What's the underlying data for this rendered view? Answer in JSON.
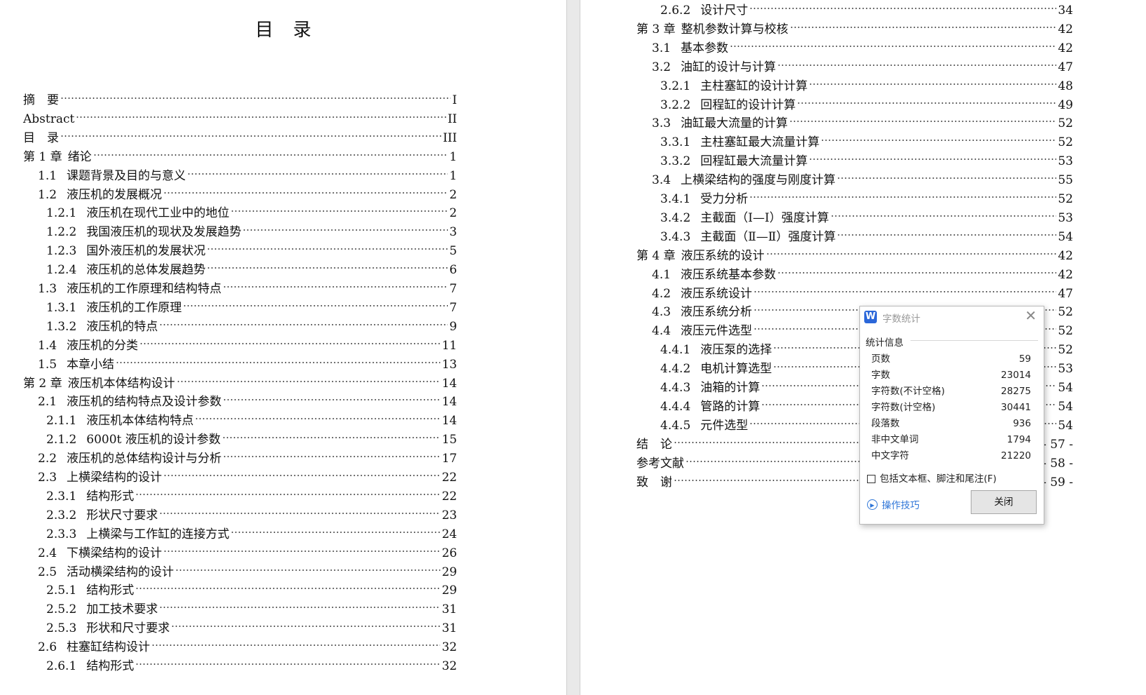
{
  "left_page": {
    "title": "目录",
    "entries": [
      {
        "level": 0,
        "num": "",
        "title": "摘　要",
        "page": "I"
      },
      {
        "level": 0,
        "num": "",
        "title": "Abstract",
        "page": "II"
      },
      {
        "level": 0,
        "num": "",
        "title": "目　录",
        "page": "III"
      },
      {
        "level": 1,
        "num": "第 1 章",
        "title": "绪论",
        "page": "1"
      },
      {
        "level": 2,
        "num": "1.1",
        "title": "课题背景及目的与意义",
        "page": "1"
      },
      {
        "level": 2,
        "num": "1.2",
        "title": "液压机的发展概况",
        "page": "2"
      },
      {
        "level": 3,
        "num": "1.2.1",
        "title": "液压机在现代工业中的地位",
        "page": "2"
      },
      {
        "level": 3,
        "num": "1.2.2",
        "title": "我国液压机的现状及发展趋势",
        "page": "3"
      },
      {
        "level": 3,
        "num": "1.2.3",
        "title": "国外液压机的发展状况",
        "page": "5"
      },
      {
        "level": 3,
        "num": "1.2.4",
        "title": "液压机的总体发展趋势",
        "page": "6"
      },
      {
        "level": 2,
        "num": "1.3",
        "title": "液压机的工作原理和结构特点",
        "page": "7"
      },
      {
        "level": 3,
        "num": "1.3.1",
        "title": "液压机的工作原理",
        "page": "7"
      },
      {
        "level": 3,
        "num": "1.3.2",
        "title": "液压机的特点",
        "page": "9"
      },
      {
        "level": 2,
        "num": "1.4",
        "title": "液压机的分类",
        "page": "11"
      },
      {
        "level": 2,
        "num": "1.5",
        "title": "本章小结",
        "page": "13"
      },
      {
        "level": 1,
        "num": "第 2 章",
        "title": "液压机本体结构设计",
        "page": "14"
      },
      {
        "level": 2,
        "num": "2.1",
        "title": "液压机的结构特点及设计参数",
        "page": "14"
      },
      {
        "level": 3,
        "num": "2.1.1",
        "title": "液压机本体结构特点",
        "page": "14"
      },
      {
        "level": 3,
        "num": "2.1.2",
        "title": "6000t 液压机的设计参数",
        "page": "15"
      },
      {
        "level": 2,
        "num": "2.2",
        "title": "液压机的总体结构设计与分析",
        "page": "17"
      },
      {
        "level": 2,
        "num": "2.3",
        "title": "上横梁结构的设计",
        "page": "22"
      },
      {
        "level": 3,
        "num": "2.3.1",
        "title": "结构形式",
        "page": "22"
      },
      {
        "level": 3,
        "num": "2.3.2",
        "title": "形状尺寸要求",
        "page": "23"
      },
      {
        "level": 3,
        "num": "2.3.3",
        "title": "上横梁与工作缸的连接方式",
        "page": "24"
      },
      {
        "level": 2,
        "num": "2.4",
        "title": "下横梁结构的设计",
        "page": "26"
      },
      {
        "level": 2,
        "num": "2.5",
        "title": "活动横梁结构的设计",
        "page": "29"
      },
      {
        "level": 3,
        "num": "2.5.1",
        "title": "结构形式",
        "page": "29"
      },
      {
        "level": 3,
        "num": "2.5.2",
        "title": "加工技术要求",
        "page": "31"
      },
      {
        "level": 3,
        "num": "2.5.3",
        "title": "形状和尺寸要求",
        "page": "31"
      },
      {
        "level": 2,
        "num": "2.6",
        "title": "柱塞缸结构设计",
        "page": "32"
      },
      {
        "level": 3,
        "num": "2.6.1",
        "title": "结构形式",
        "page": "32"
      }
    ]
  },
  "right_page": {
    "entries": [
      {
        "level": 3,
        "num": "2.6.2",
        "title": "设计尺寸",
        "page": "34"
      },
      {
        "level": 1,
        "num": "第 3 章",
        "title": "整机参数计算与校核",
        "page": "42"
      },
      {
        "level": 2,
        "num": "3.1",
        "title": "基本参数",
        "page": "42"
      },
      {
        "level": 2,
        "num": "3.2",
        "title": "油缸的设计与计算",
        "page": "47"
      },
      {
        "level": 3,
        "num": "3.2.1",
        "title": "主柱塞缸的设计计算",
        "page": "48"
      },
      {
        "level": 3,
        "num": "3.2.2",
        "title": "回程缸的设计计算",
        "page": "49"
      },
      {
        "level": 2,
        "num": "3.3",
        "title": "油缸最大流量的计算",
        "page": "52"
      },
      {
        "level": 3,
        "num": "3.3.1",
        "title": "主柱塞缸最大流量计算",
        "page": "52"
      },
      {
        "level": 3,
        "num": "3.3.2",
        "title": "回程缸最大流量计算",
        "page": "53"
      },
      {
        "level": 2,
        "num": "3.4",
        "title": "上横梁结构的强度与刚度计算",
        "page": "55"
      },
      {
        "level": 3,
        "num": "3.4.1",
        "title": "受力分析",
        "page": "52"
      },
      {
        "level": 3,
        "num": "3.4.2",
        "title": "主截面（Ⅰ—Ⅰ）强度计算",
        "page": "53"
      },
      {
        "level": 3,
        "num": "3.4.3",
        "title": "主截面（Ⅱ—Ⅱ）强度计算",
        "page": "54"
      },
      {
        "level": 1,
        "num": "第 4 章",
        "title": "液压系统的设计",
        "page": "42"
      },
      {
        "level": 2,
        "num": "4.1",
        "title": "液压系统基本参数",
        "page": "42"
      },
      {
        "level": 2,
        "num": "4.2",
        "title": "液压系统设计",
        "page": "47"
      },
      {
        "level": 2,
        "num": "4.3",
        "title": "液压系统分析",
        "page": "52"
      },
      {
        "level": 2,
        "num": "4.4",
        "title": "液压元件选型",
        "page": "52"
      },
      {
        "level": 3,
        "num": "4.4.1",
        "title": "液压泵的选择",
        "page": "52"
      },
      {
        "level": 3,
        "num": "4.4.2",
        "title": "电机计算选型",
        "page": "53"
      },
      {
        "level": 3,
        "num": "4.4.3",
        "title": "油箱的计算",
        "page": "54"
      },
      {
        "level": 3,
        "num": "4.4.4",
        "title": "管路的计算",
        "page": "54"
      },
      {
        "level": 3,
        "num": "4.4.5",
        "title": "元件选型",
        "page": "54"
      },
      {
        "level": 0,
        "num": "",
        "title": "结　论",
        "page": "- 57 -"
      },
      {
        "level": 0,
        "num": "",
        "title": "参考文献",
        "page": "- 58 -"
      },
      {
        "level": 0,
        "num": "",
        "title": "致　谢",
        "page": "- 59 -"
      }
    ]
  },
  "dialog": {
    "app_icon": "W",
    "title": "字数统计",
    "close_glyph": "✕",
    "group_label": "统计信息",
    "stats": [
      {
        "label": "页数",
        "value": "59"
      },
      {
        "label": "字数",
        "value": "23014"
      },
      {
        "label": "字符数(不计空格)",
        "value": "28275"
      },
      {
        "label": "字符数(计空格)",
        "value": "30441"
      },
      {
        "label": "段落数",
        "value": "936"
      },
      {
        "label": "非中文单词",
        "value": "1794"
      },
      {
        "label": "中文字符",
        "value": "21220"
      }
    ],
    "checkbox_label": "包括文本框、脚注和尾注(F)",
    "checkbox_checked": false,
    "tips_label": "操作技巧",
    "close_button_label": "关闭",
    "accent_color": "#2f76d8"
  }
}
